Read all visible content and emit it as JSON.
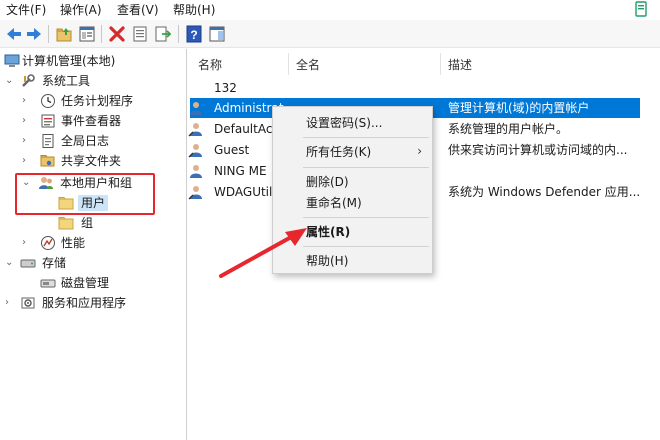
{
  "menubar": {
    "items": [
      "文件(F)",
      "操作(A)",
      "查看(V)",
      "帮助(H)"
    ]
  },
  "toolbar": {
    "icons": [
      "back-icon",
      "forward-icon",
      "up-folder-icon",
      "show-hide-tree-icon",
      "delete-icon",
      "properties-icon",
      "export-icon",
      "help-icon",
      "action-pane-icon"
    ]
  },
  "tree": {
    "root": "计算机管理(本地)",
    "system_tools": "系统工具",
    "task_scheduler": "任务计划程序",
    "event_viewer": "事件查看器",
    "global_log": "全局日志",
    "shared_folders": "共享文件夹",
    "local_users_groups": "本地用户和组",
    "users": "用户",
    "groups": "组",
    "performance": "性能",
    "storage": "存储",
    "disk_management": "磁盘管理",
    "services_apps": "服务和应用程序"
  },
  "list": {
    "columns": [
      "名称",
      "全名",
      "描述"
    ],
    "rows": [
      {
        "name": "132",
        "description": ""
      },
      {
        "name": "Administrat",
        "description": "管理计算机(域)的内置帐户"
      },
      {
        "name": "DefaultAcc",
        "description": "系统管理的用户帐户。"
      },
      {
        "name": "Guest",
        "description": "供来宾访问计算机或访问域的内..."
      },
      {
        "name": "NING ME",
        "description": ""
      },
      {
        "name": "WDAGUtil",
        "description": "系统为 Windows Defender 应用..."
      }
    ]
  },
  "context_menu": {
    "set_password": "设置密码(S)...",
    "all_tasks": "所有任务(K)",
    "all_tasks_arrow": "›",
    "delete": "删除(D)",
    "rename": "重命名(M)",
    "properties": "属性(R)",
    "help": "帮助(H)"
  },
  "colors": {
    "selection": "#0078d7",
    "annotation_red": "#e8262e",
    "tree_selection": "#cce4f7"
  }
}
